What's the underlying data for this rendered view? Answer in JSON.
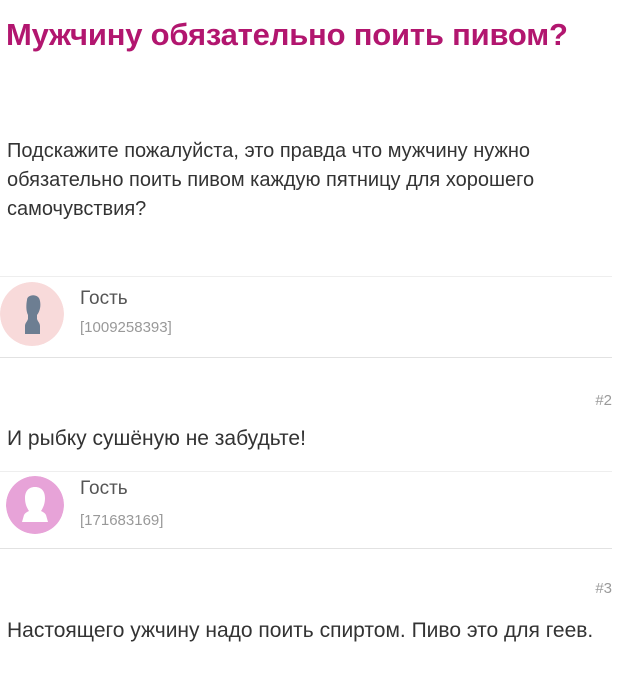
{
  "topic": {
    "title": "Мужчину обязательно поить пивом?",
    "question": "Подскажите пожалуйста, это правда что мужчину нужно обязательно поить пивом каждую пятницу для хорошего самочувствия?",
    "author": {
      "name": "Гость",
      "id": "[1009258393]",
      "avatar_icon": "male-silhouette-icon",
      "avatar_bg": "#f8dada",
      "avatar_fg": "#6d7e92"
    }
  },
  "comments": [
    {
      "number": "#2",
      "text": "И рыбку сушёную не забудьте!",
      "author": {
        "name": "Гость",
        "id": "[171683169]",
        "avatar_icon": "female-silhouette-icon",
        "avatar_bg": "#e7a3d8",
        "avatar_fg": "#ffffff"
      }
    },
    {
      "number": "#3",
      "text": "Настоящего ужчину надо поить спиртом. Пиво это для геев."
    }
  ],
  "colors": {
    "title": "#b2166f",
    "text": "#333333",
    "muted": "#999999",
    "divider": "#e2e2e2"
  }
}
